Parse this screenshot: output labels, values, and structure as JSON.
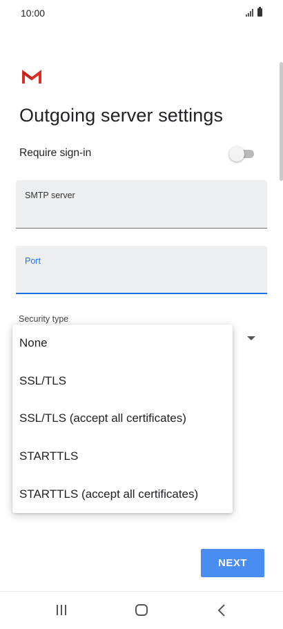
{
  "status_bar": {
    "time": "10:00",
    "icons": [
      "signal-icon",
      "battery-icon"
    ]
  },
  "app": {
    "logo": "gmail-logo",
    "title": "Outgoing server settings"
  },
  "require_signin": {
    "label": "Require sign-in",
    "enabled": false
  },
  "fields": {
    "smtp": {
      "label": "SMTP server",
      "value": ""
    },
    "port": {
      "label": "Port",
      "value": ""
    }
  },
  "security": {
    "label": "Security type",
    "options": [
      "None",
      "SSL/TLS",
      "SSL/TLS (accept all certificates)",
      "STARTTLS",
      "STARTTLS (accept all certificates)"
    ]
  },
  "actions": {
    "next_label": "NEXT"
  },
  "nav_bar": {
    "icons": [
      "recent-apps-icon",
      "home-icon",
      "back-icon"
    ]
  },
  "colors": {
    "accent": "#1a73e8",
    "button": "#4a8df0",
    "field_bg": "#eeeff0",
    "gmail_red": "#d93025"
  }
}
